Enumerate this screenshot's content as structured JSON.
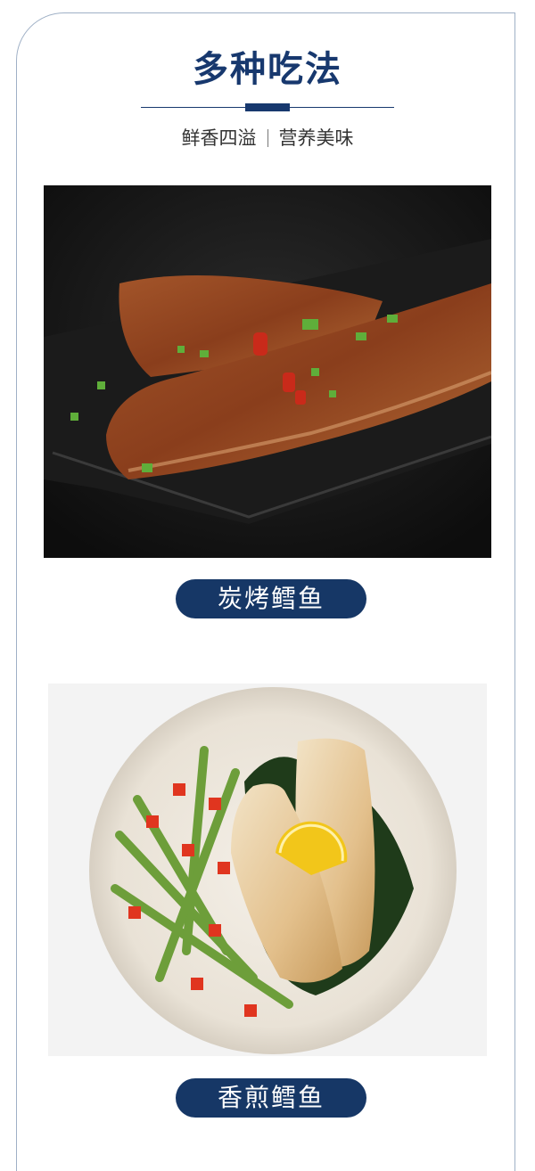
{
  "header": {
    "title": "多种吃法",
    "subtitle_left": "鲜香四溢",
    "subtitle_right": "营养美味"
  },
  "dishes": [
    {
      "label": "炭烤鳕鱼"
    },
    {
      "label": "香煎鳕鱼"
    }
  ],
  "colors": {
    "primary": "#163766",
    "frame": "#9fb0c6"
  }
}
